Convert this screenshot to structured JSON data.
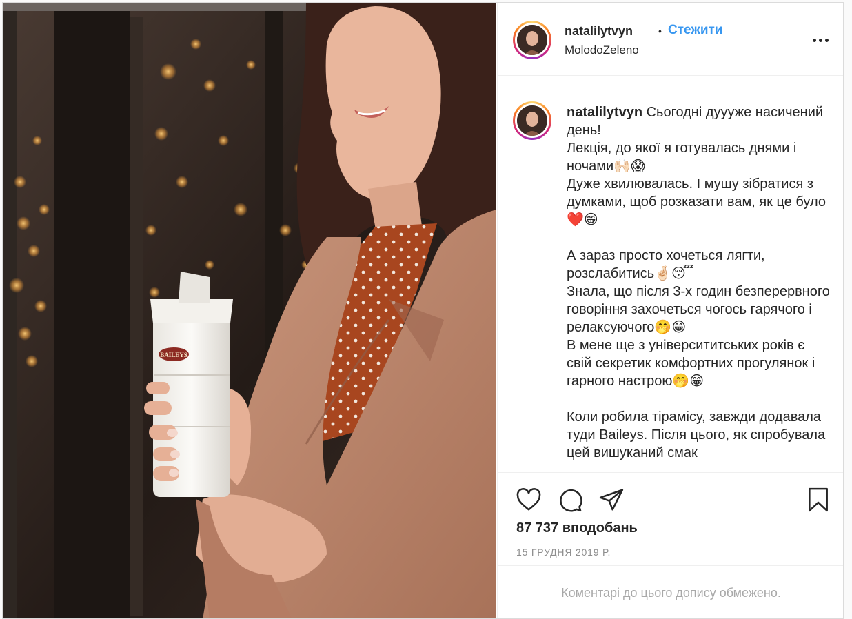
{
  "post": {
    "username": "natalilytvyn",
    "separator": "•",
    "follow_label": "Стежити",
    "location": "MolodoZeleno",
    "more_icon": "more-horizontal-icon",
    "caption_username": "natalilytvyn",
    "caption_text": " Сьогодні дуууже насичений день!\nЛекція, до якої я готувалась днями і ночами🙌🏻😱\nДуже хвилювалась. І мушу зібратися з думками, щоб розказати вам, як це було❤️😁\n\nА зараз просто хочеться лягти, розслабитись🤞🏻😴\nЗнала, що після 3-х годин безперервного говоріння захочеться чогось гарячого і релаксуючого🤭😁\nВ мене ще з університитських років є свій секретик комфортних прогулянок і гарного настрою🤭😁\n\nКоли робила тірамісу, завжди додавала туди Baileys. Після цього, як спробувала цей вишуканий смак",
    "likes": "87 737 вподобань",
    "date": "15 ГРУДНЯ 2019 Р.",
    "comments_limited": "Коментарі до цього допису обмежено.",
    "photo_cup_brand": "BAILEYS"
  },
  "colors": {
    "accent": "#3897f0",
    "text": "#262626",
    "muted": "#8e8e8e"
  }
}
